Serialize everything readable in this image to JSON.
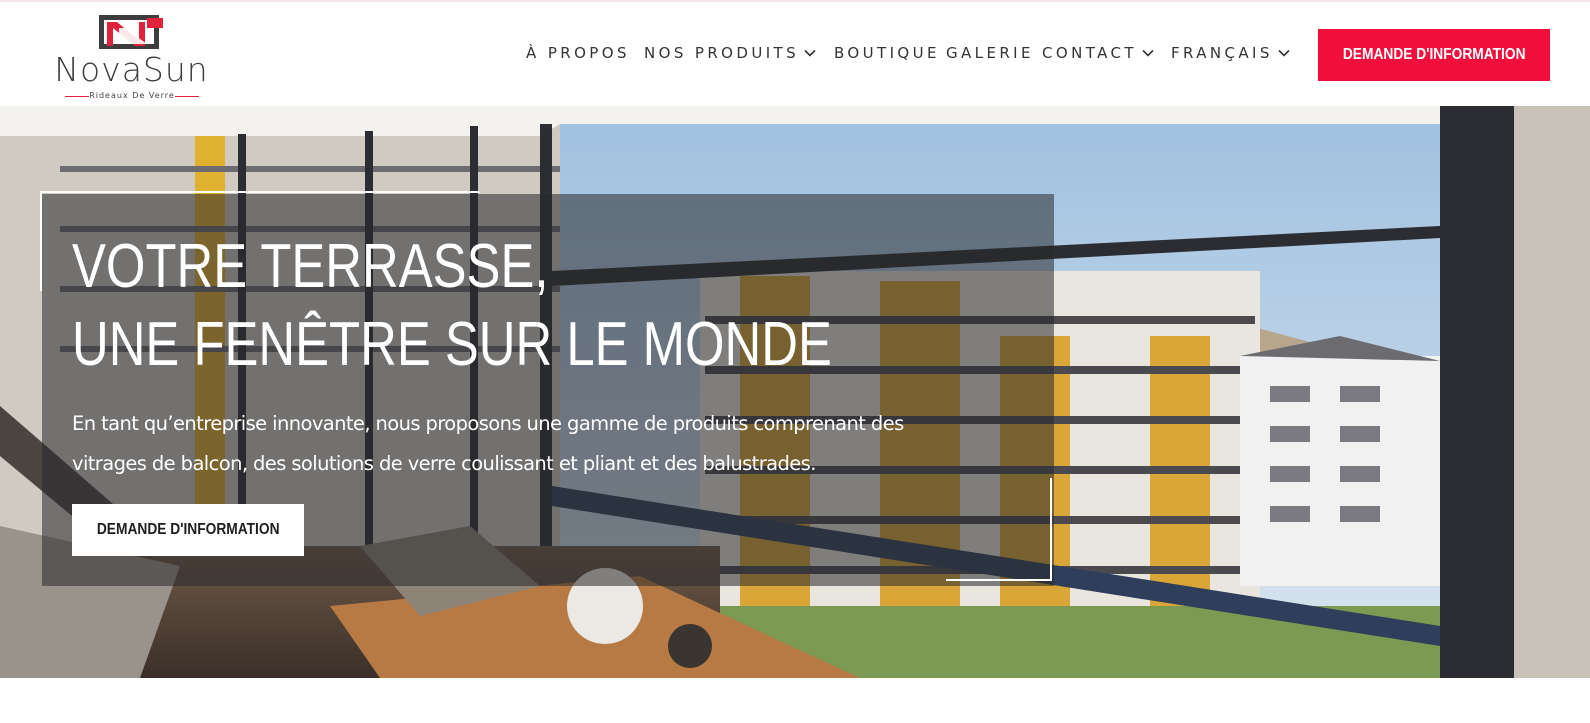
{
  "brand": {
    "name": "NovaSun",
    "tagline": "Rideaux De Verre",
    "colors": {
      "accent": "#f20f3c",
      "logo_red": "#e0233a",
      "logo_dark": "#3d3d3d"
    }
  },
  "nav": {
    "items": [
      {
        "label": "À PROPOS",
        "has_dropdown": false
      },
      {
        "label": "NOS PRODUITS",
        "has_dropdown": true,
        "icon": "chevron-down-icon"
      },
      {
        "label": "BOUTIQUE",
        "has_dropdown": false
      },
      {
        "label": "GALERIE",
        "has_dropdown": false
      },
      {
        "label": "CONTACT",
        "has_dropdown": true,
        "icon": "chevron-down-icon"
      },
      {
        "label": "FRANÇAIS",
        "has_dropdown": true,
        "icon": "chevron-down-icon"
      }
    ],
    "cta_label": "DEMANDE D'INFORMATION"
  },
  "hero": {
    "headline_line1": "VOTRE TERRASSE,",
    "headline_line2": "UNE FENÊTRE SUR LE MONDE",
    "description": "En tant qu’entreprise innovante, nous proposons une gamme de produits comprenant des vitrages de balcon, des solutions de verre coulissant et pliant et des balustrades.",
    "cta_label": "DEMANDE D'INFORMATION",
    "image_icon": "balcony-photo"
  }
}
